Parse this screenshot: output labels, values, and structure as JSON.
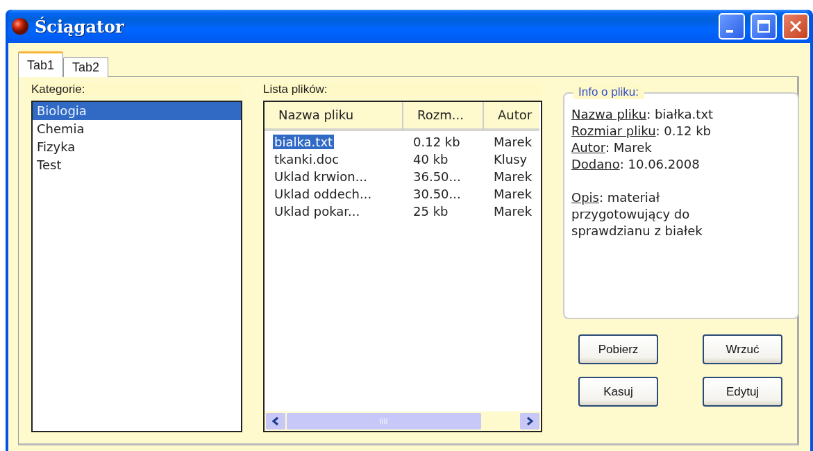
{
  "window": {
    "title": "Ściągator"
  },
  "tabs": [
    {
      "label": "Tab1",
      "selected": true
    },
    {
      "label": "Tab2",
      "selected": false
    }
  ],
  "categories": {
    "label": "Kategorie:",
    "items": [
      {
        "name": "Biologia",
        "selected": true
      },
      {
        "name": "Chemia",
        "selected": false
      },
      {
        "name": "Fizyka",
        "selected": false
      },
      {
        "name": "Test",
        "selected": false
      }
    ]
  },
  "files": {
    "label": "Lista plików:",
    "columns": [
      "Nazwa pliku",
      "Rozm...",
      "Autor"
    ],
    "rows": [
      {
        "cells": [
          "bialka.txt",
          "0.12 kb",
          "Marek"
        ],
        "selected": true
      },
      {
        "cells": [
          "tkanki.doc",
          "40 kb",
          "Klusy"
        ],
        "selected": false
      },
      {
        "cells": [
          "Uklad krwion...",
          "36.50...",
          "Marek"
        ],
        "selected": false
      },
      {
        "cells": [
          "Uklad oddech...",
          "30.50...",
          "Marek"
        ],
        "selected": false
      },
      {
        "cells": [
          "Uklad pokar...",
          "25 kb",
          "Marek"
        ],
        "selected": false
      }
    ]
  },
  "info": {
    "title": "Info o pliku:",
    "lines": [
      {
        "label": "Nazwa pliku",
        "value": ": białka.txt"
      },
      {
        "label": "Rozmiar pliku",
        "value": ": 0.12 kb"
      },
      {
        "label": "Autor",
        "value": ": Marek"
      },
      {
        "label": "Dodano",
        "value": ": 10.06.2008"
      }
    ],
    "description": {
      "label": "Opis",
      "value": ": materiał przygotowujący do sprawdzianu z białek"
    }
  },
  "buttons": [
    {
      "label": "Pobierz"
    },
    {
      "label": "Wrzuć"
    },
    {
      "label": "Kasuj"
    },
    {
      "label": "Edytuj"
    }
  ]
}
